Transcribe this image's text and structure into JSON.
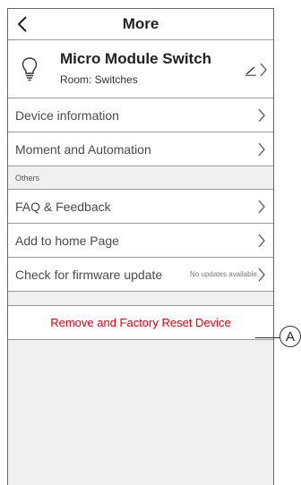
{
  "header": {
    "title": "More"
  },
  "device": {
    "name": "Micro Module Switch",
    "room": "Room: Switches"
  },
  "menu_items": [
    {
      "label": "Device information"
    },
    {
      "label": "Moment and Automation"
    }
  ],
  "others": {
    "section_label": "Others",
    "items": [
      {
        "label": "FAQ & Feedback"
      },
      {
        "label": "Add to home Page"
      },
      {
        "label": "Check for firmware update",
        "status": "No updates available."
      }
    ]
  },
  "remove": {
    "label": "Remove and Factory Reset Device"
  },
  "callout": {
    "label": "A"
  },
  "colors": {
    "accent_red": "#e0000f",
    "divider": "#9a9a9a",
    "background": "#f0f0f0"
  }
}
